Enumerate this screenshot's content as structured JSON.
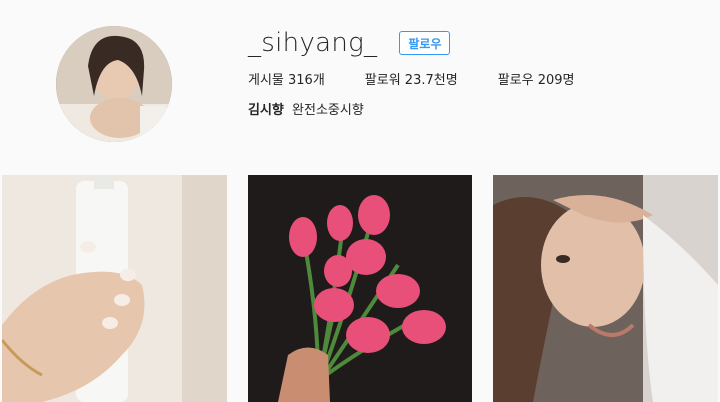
{
  "profile": {
    "username": "_sihyang_",
    "follow_label": "팔로우",
    "stats": {
      "posts": "게시물 316개",
      "followers": "팔로워 23.7천명",
      "following": "팔로우 209명"
    },
    "bio_name": "김시향",
    "bio_text": "완전소중시향"
  },
  "grid": {
    "posts": [
      {
        "alt": "hand holding spray bottle"
      },
      {
        "alt": "pink tulips bouquet"
      },
      {
        "alt": "woman portrait"
      }
    ]
  },
  "colors": {
    "accent": "#3897f0",
    "text": "#262626",
    "background": "#fafafa"
  }
}
